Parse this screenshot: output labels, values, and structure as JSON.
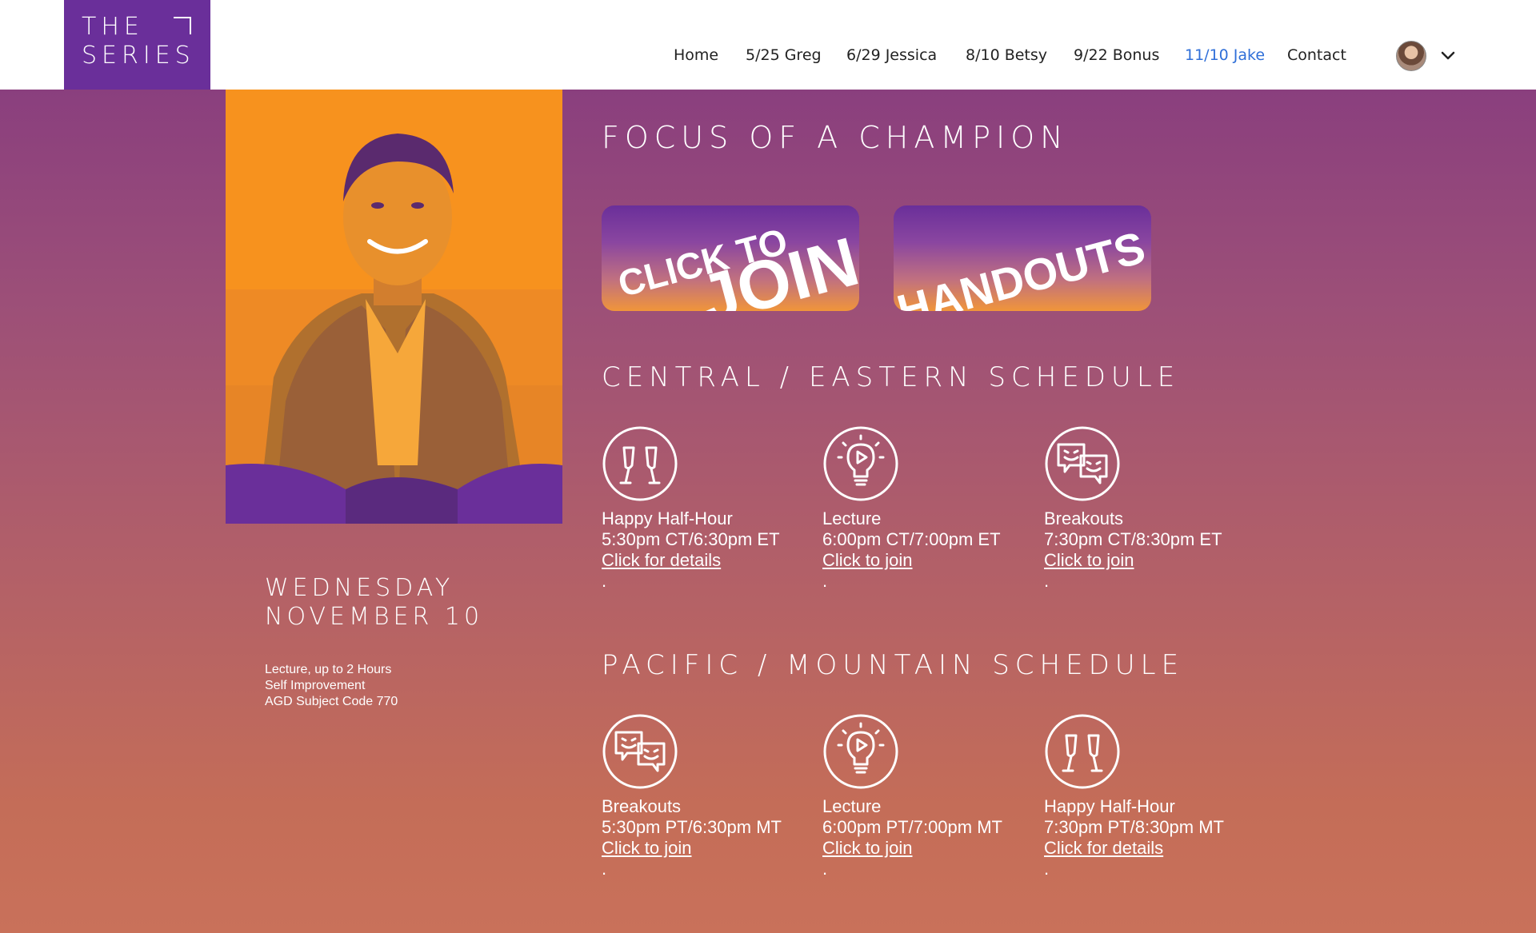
{
  "logo": {
    "line1": "THE",
    "line2": "SERIES"
  },
  "nav": {
    "items": [
      {
        "label": "Home"
      },
      {
        "label": "5/25 Greg"
      },
      {
        "label": "6/29 Jessica"
      },
      {
        "label": "8/10 Betsy"
      },
      {
        "label": "9/22 Bonus"
      },
      {
        "label": "11/10 Jake",
        "active": true
      },
      {
        "label": "Contact"
      }
    ]
  },
  "event": {
    "title": "FOCUS OF A CHAMPION",
    "day": "WEDNESDAY",
    "date": "NOVEMBER 10",
    "info": [
      "Lecture, up to 2 Hours",
      "Self Improvement",
      "AGD Subject Code 770"
    ]
  },
  "buttons": {
    "join": {
      "line1": "CLICK TO",
      "line2": "JOIN"
    },
    "handouts": {
      "label": "HANDOUTS"
    }
  },
  "schedules": [
    {
      "title": "CENTRAL / EASTERN SCHEDULE",
      "items": [
        {
          "icon": "champagne-icon",
          "name": "Happy Half-Hour",
          "time": "5:30pm CT/6:30pm ET",
          "link": "Click for details"
        },
        {
          "icon": "lightbulb-play-icon",
          "name": "Lecture",
          "time": "6:00pm CT/7:00pm ET",
          "link": "Click to join"
        },
        {
          "icon": "chat-faces-icon",
          "name": "Breakouts",
          "time": "7:30pm CT/8:30pm ET",
          "link": "Click to join"
        }
      ]
    },
    {
      "title": "PACIFIC / MOUNTAIN SCHEDULE",
      "items": [
        {
          "icon": "chat-faces-icon",
          "name": "Breakouts",
          "time": "5:30pm PT/6:30pm MT",
          "link": "Click to join"
        },
        {
          "icon": "lightbulb-play-icon",
          "name": "Lecture",
          "time": "6:00pm PT/7:00pm MT",
          "link": "Click to join"
        },
        {
          "icon": "champagne-icon",
          "name": "Happy Half-Hour",
          "time": "7:30pm PT/8:30pm MT",
          "link": "Click for details"
        }
      ]
    }
  ],
  "colors": {
    "brand_purple": "#6a2f9a",
    "active_nav": "#2f6fd8",
    "photo_orange": "#f7921e",
    "gradient_top": "#8a3f7e",
    "gradient_bottom": "#c9715a"
  }
}
